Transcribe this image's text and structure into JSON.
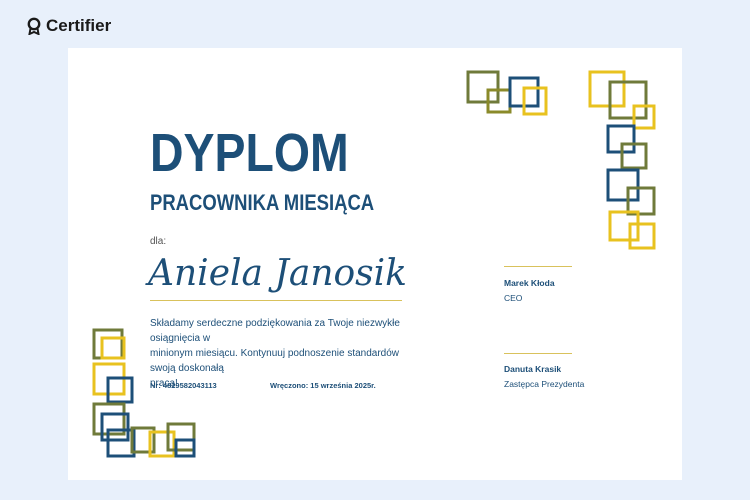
{
  "brand": {
    "name": "Certifier"
  },
  "certificate": {
    "title": "DYPLOM",
    "subtitle": "PRACOWNIKA MIESIĄCA",
    "for_label": "dla:",
    "recipient": "Aniela Janosik",
    "body_lines": [
      "Składamy serdeczne podziękowania za Twoje niezwykłe osiągnięcia w",
      "minionym miesiącu. Kontynuuj podnoszenie standardów swoją doskonałą",
      "pracą!"
    ],
    "number": "Nr: 4829582043113",
    "issued": "Wręczono: 15 września 2025r.",
    "signatories": [
      {
        "name": "Marek Kłoda",
        "role": "CEO"
      },
      {
        "name": "Danuta Krasik",
        "role": "Zastępca Prezydenta"
      }
    ]
  },
  "colors": {
    "navy": "#1d4f78",
    "gold": "#e8c21f",
    "olive": "#6f7a3a",
    "page_background": "#e8f0fb"
  }
}
